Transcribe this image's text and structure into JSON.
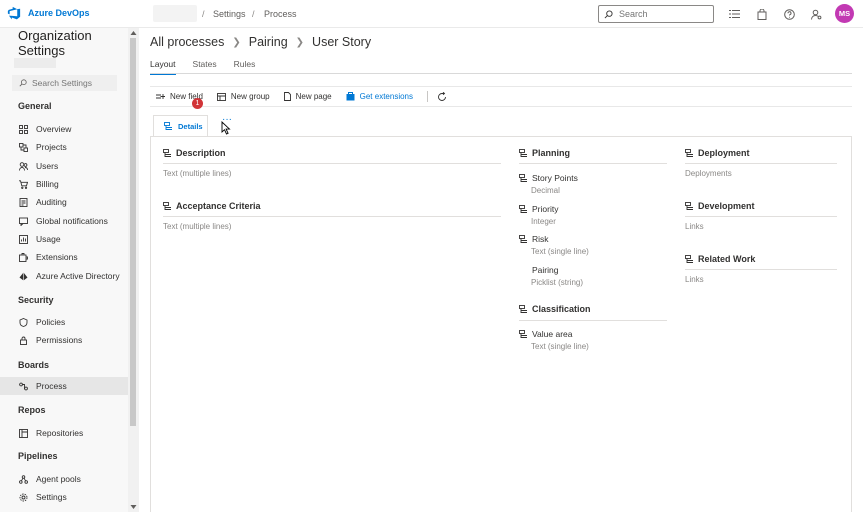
{
  "header": {
    "brand": "Azure DevOps",
    "breadcrumb": [
      "Settings",
      "Process"
    ],
    "separator": "/",
    "search_placeholder": "Search",
    "avatar_initials": "MS",
    "avatar_color": "#c239b3",
    "icons": [
      "list-icon",
      "shopping-bag-icon",
      "help-icon",
      "user-settings-icon"
    ]
  },
  "sidebar": {
    "title": "Organization Settings",
    "search_placeholder": "Search Settings",
    "sections": [
      {
        "heading": "General",
        "items": [
          {
            "label": "Overview",
            "icon": "overview-icon"
          },
          {
            "label": "Projects",
            "icon": "projects-icon"
          },
          {
            "label": "Users",
            "icon": "users-icon"
          },
          {
            "label": "Billing",
            "icon": "cart-icon"
          },
          {
            "label": "Auditing",
            "icon": "auditing-icon"
          },
          {
            "label": "Global notifications",
            "icon": "notifications-icon"
          },
          {
            "label": "Usage",
            "icon": "usage-icon"
          },
          {
            "label": "Extensions",
            "icon": "extensions-icon"
          },
          {
            "label": "Azure Active Directory",
            "icon": "azure-ad-icon"
          }
        ]
      },
      {
        "heading": "Security",
        "items": [
          {
            "label": "Policies",
            "icon": "policies-icon"
          },
          {
            "label": "Permissions",
            "icon": "permissions-icon"
          }
        ]
      },
      {
        "heading": "Boards",
        "items": [
          {
            "label": "Process",
            "icon": "process-icon",
            "selected": true
          }
        ]
      },
      {
        "heading": "Repos",
        "items": [
          {
            "label": "Repositories",
            "icon": "repositories-icon"
          }
        ]
      },
      {
        "heading": "Pipelines",
        "items": [
          {
            "label": "Agent pools",
            "icon": "agent-pools-icon"
          },
          {
            "label": "Settings",
            "icon": "settings-gear-icon"
          }
        ]
      }
    ]
  },
  "main": {
    "breadcrumb": [
      "All processes",
      "Pairing",
      "User Story"
    ],
    "tabs": [
      {
        "label": "Layout",
        "active": true
      },
      {
        "label": "States"
      },
      {
        "label": "Rules"
      }
    ],
    "toolbar": {
      "new_field": "New field",
      "new_group": "New group",
      "new_page": "New page",
      "get_extensions": "Get extensions",
      "badge_count": "1"
    },
    "page_tab": {
      "label": "Details",
      "more": "···"
    },
    "columns": {
      "left": [
        {
          "title": "Description",
          "fields": [
            {
              "type": "Text (multiple lines)"
            }
          ]
        },
        {
          "title": "Acceptance Criteria",
          "fields": [
            {
              "type": "Text (multiple lines)"
            }
          ]
        }
      ],
      "middle": [
        {
          "title": "Planning",
          "fields": [
            {
              "name": "Story Points",
              "type": "Decimal"
            },
            {
              "name": "Priority",
              "type": "Integer"
            },
            {
              "name": "Risk",
              "type": "Text (single line)"
            },
            {
              "name": "Pairing",
              "type": "Picklist (string)"
            }
          ]
        },
        {
          "title": "Classification",
          "fields": [
            {
              "name": "Value area",
              "type": "Text (single line)"
            }
          ]
        }
      ],
      "right": [
        {
          "title": "Deployment",
          "fields": [
            {
              "type": "Deployments"
            }
          ]
        },
        {
          "title": "Development",
          "fields": [
            {
              "type": "Links"
            }
          ]
        },
        {
          "title": "Related Work",
          "fields": [
            {
              "type": "Links"
            }
          ]
        }
      ]
    }
  }
}
